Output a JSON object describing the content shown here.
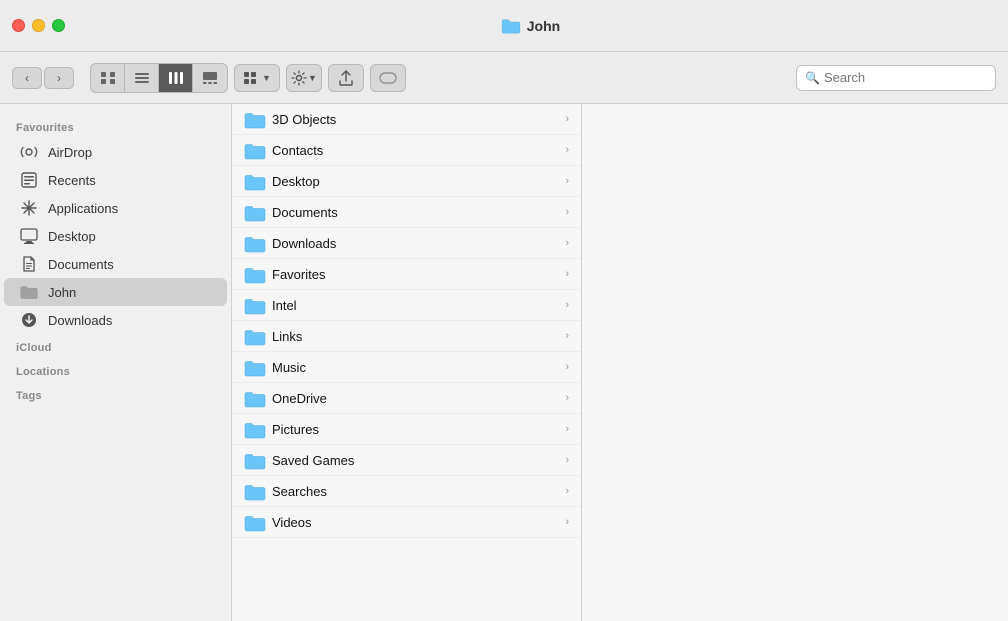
{
  "titlebar": {
    "title": "John",
    "folder_icon": "📁"
  },
  "toolbar": {
    "nav_back": "‹",
    "nav_forward": "›",
    "view_icons_label": "icons",
    "view_list_label": "list",
    "view_columns_label": "columns",
    "view_gallery_label": "gallery",
    "group_label": "⊞",
    "action_label": "⚙",
    "share_label": "↑",
    "tag_label": "⬡",
    "search_placeholder": "Search"
  },
  "sidebar": {
    "sections": [
      {
        "header": "Favourites",
        "items": [
          {
            "id": "airdrop",
            "label": "AirDrop",
            "icon": "airdrop"
          },
          {
            "id": "recents",
            "label": "Recents",
            "icon": "recents"
          },
          {
            "id": "applications",
            "label": "Applications",
            "icon": "applications"
          },
          {
            "id": "desktop",
            "label": "Desktop",
            "icon": "desktop"
          },
          {
            "id": "documents",
            "label": "Documents",
            "icon": "documents"
          },
          {
            "id": "john",
            "label": "John",
            "icon": "folder",
            "active": true
          },
          {
            "id": "downloads",
            "label": "Downloads",
            "icon": "downloads"
          }
        ]
      },
      {
        "header": "iCloud",
        "items": []
      },
      {
        "header": "Locations",
        "items": []
      },
      {
        "header": "Tags",
        "items": []
      }
    ]
  },
  "files": [
    {
      "name": "3D Objects",
      "has_children": true
    },
    {
      "name": "Contacts",
      "has_children": true
    },
    {
      "name": "Desktop",
      "has_children": true
    },
    {
      "name": "Documents",
      "has_children": true
    },
    {
      "name": "Downloads",
      "has_children": true
    },
    {
      "name": "Favorites",
      "has_children": true
    },
    {
      "name": "Intel",
      "has_children": true
    },
    {
      "name": "Links",
      "has_children": true
    },
    {
      "name": "Music",
      "has_children": true
    },
    {
      "name": "OneDrive",
      "has_children": true
    },
    {
      "name": "Pictures",
      "has_children": true
    },
    {
      "name": "Saved Games",
      "has_children": true
    },
    {
      "name": "Searches",
      "has_children": true
    },
    {
      "name": "Videos",
      "has_children": true
    }
  ],
  "colors": {
    "folder_blue": "#6bc5f8",
    "folder_dark": "#4da9d9",
    "sidebar_active": "#d0d0d0"
  }
}
